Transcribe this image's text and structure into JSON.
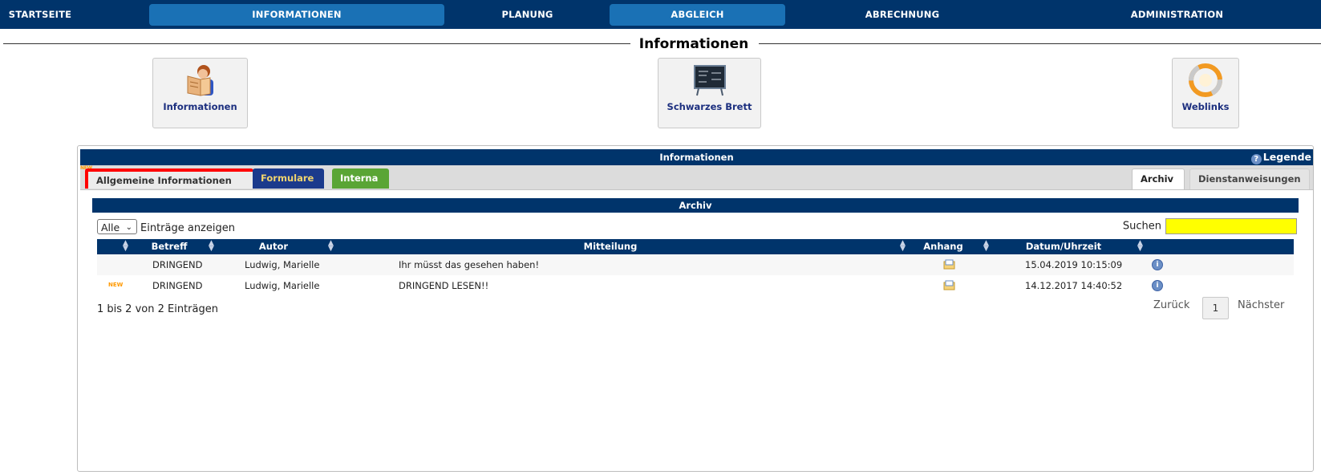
{
  "nav": {
    "items": [
      {
        "label": "STARTSEITE"
      },
      {
        "label": "INFORMATIONEN"
      },
      {
        "label": "PLANUNG"
      },
      {
        "label": "ABGLEICH"
      },
      {
        "label": "ABRECHNUNG"
      },
      {
        "label": "ADMINISTRATION"
      }
    ]
  },
  "page": {
    "title": "Informationen"
  },
  "tiles": {
    "informationen": "Informationen",
    "brett": "Schwarzes Brett",
    "weblinks": "Weblinks"
  },
  "panel": {
    "title": "Informationen",
    "legend": "Legende",
    "tabs": {
      "allgemein": "Allgemeine Informationen",
      "formulare": "Formulare",
      "interna": "Interna",
      "archiv": "Archiv",
      "dienst": "Dienstanweisungen"
    },
    "new_badge": "NEW"
  },
  "archive": {
    "heading": "Archiv",
    "length_value": "Alle",
    "length_suffix": "Einträge anzeigen",
    "search_label": "Suchen",
    "columns": [
      "Betreff",
      "Autor",
      "Mitteilung",
      "Anhang",
      "Datum/Uhrzeit"
    ],
    "rows": [
      {
        "betreff": "DRINGEND",
        "autor": "Ludwig, Marielle",
        "mitteilung": "Ihr müsst das gesehen haben!",
        "datum": "15.04.2019 10:15:09",
        "new": ""
      },
      {
        "betreff": "DRINGEND",
        "autor": "Ludwig, Marielle",
        "mitteilung": "DRINGEND LESEN!!",
        "datum": "14.12.2017 14:40:52",
        "new": "NEW"
      }
    ],
    "info_text": "1 bis 2 von 2 Einträgen",
    "pager": {
      "prev": "Zurück",
      "page": "1",
      "next": "Nächster"
    }
  },
  "colors": {
    "nav_bg": "#00346b",
    "nav_active": "#1a71b5",
    "search_bg": "#ffff00",
    "tab_alert": "#ff0000",
    "tab_formulare": "#1b3a8c",
    "tab_interna": "#5aa535"
  }
}
